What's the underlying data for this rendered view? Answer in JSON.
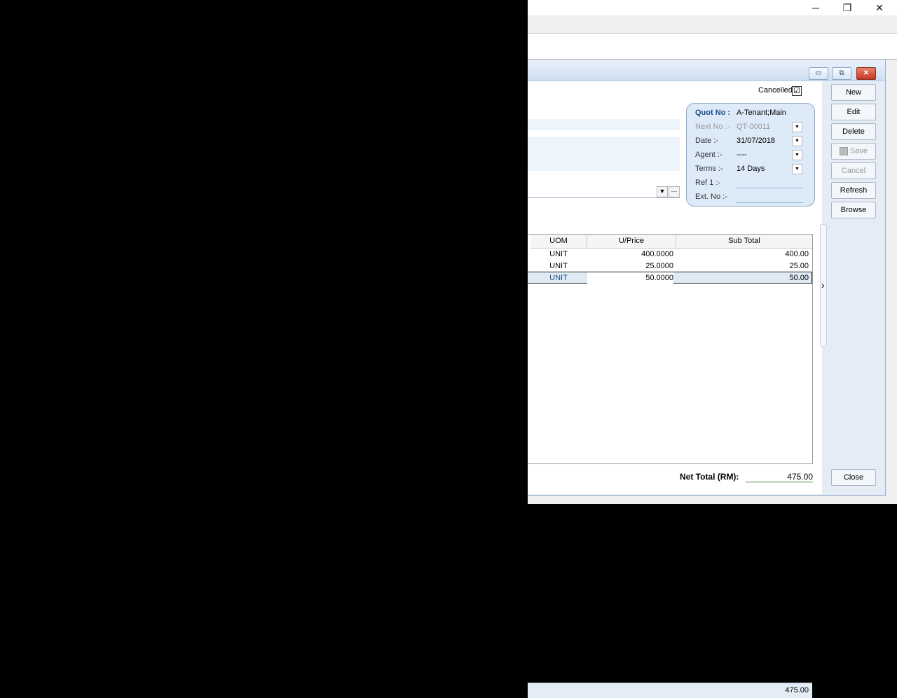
{
  "window": {
    "minimize_glyph": "─",
    "maximize_glyph": "❐",
    "close_glyph": "✕"
  },
  "mdi": {
    "minimize_glyph": "▭",
    "restore_glyph": "⧉",
    "close_glyph": "✕"
  },
  "cancelled_label": "Cancelled",
  "cancelled_checked": "☑",
  "header": {
    "quot_no_label": "Quot No :",
    "quot_no_value": "A-Tenant;Main",
    "next_no_label": "Next No :-",
    "next_no_value": "QT-00011",
    "date_label": "Date :-",
    "date_value": "31/07/2018",
    "agent_label": "Agent :-",
    "agent_value": "----",
    "terms_label": "Terms :-",
    "terms_value": "14 Days",
    "ref1_label": "Ref 1 :-",
    "extno_label": "Ext. No :-"
  },
  "grid": {
    "columns": [
      "UOM",
      "U/Price",
      "Sub Total"
    ],
    "rows": [
      {
        "uom": "UNIT",
        "uprice": "400.0000",
        "subtotal": "400.00"
      },
      {
        "uom": "UNIT",
        "uprice": "25.0000",
        "subtotal": "25.00"
      },
      {
        "uom": "UNIT",
        "uprice": "50.0000",
        "subtotal": "50.00"
      }
    ],
    "footer_total": "475.00"
  },
  "net_total_label": "Net Total (RM):",
  "net_total_value": "475.00",
  "buttons": {
    "new": "New",
    "edit": "Edit",
    "delete": "Delete",
    "save": "Save",
    "cancel": "Cancel",
    "refresh": "Refresh",
    "browse": "Browse",
    "close": "Close"
  },
  "icons": {
    "dropdown": "▼",
    "ellipsis": "···",
    "scroll_right": "›"
  }
}
